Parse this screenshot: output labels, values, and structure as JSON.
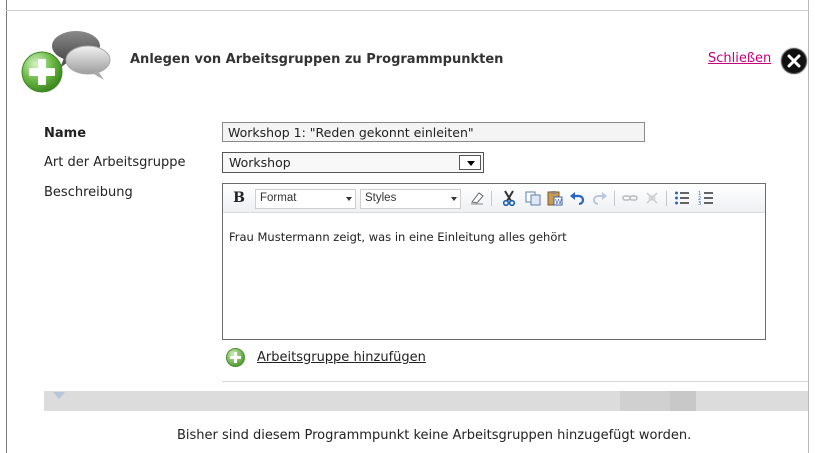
{
  "dialog": {
    "title": "Anlegen von Arbeitsgruppen zu Programmpunkten",
    "close_label": "Schließen"
  },
  "form": {
    "name_label": "Name",
    "name_value": "Workshop 1: \"Reden gekonnt einleiten\"",
    "type_label": "Art der Arbeitsgruppe",
    "type_value": "Workshop",
    "description_label": "Beschreibung"
  },
  "editor": {
    "toolbar": {
      "bold_label": "B",
      "format_label": "Format",
      "styles_label": "Styles",
      "icons": [
        "eraser-icon",
        "cut-icon",
        "copy-icon",
        "paste-word-icon",
        "undo-icon",
        "redo-icon",
        "link-icon",
        "unlink-icon",
        "bulleted-list-icon",
        "numbered-list-icon"
      ]
    },
    "content": "Frau Mustermann zeigt, was in eine Einleitung alles gehört"
  },
  "actions": {
    "add_group_label": "Arbeitsgruppe hinzufügen"
  },
  "list": {
    "empty_message": "Bisher sind diesem Programmpunkt keine Arbeitsgruppen hinzugefügt worden."
  },
  "colors": {
    "link": "#c4007a",
    "add_green": "#5aa33a",
    "band": "#dcdcdc"
  }
}
